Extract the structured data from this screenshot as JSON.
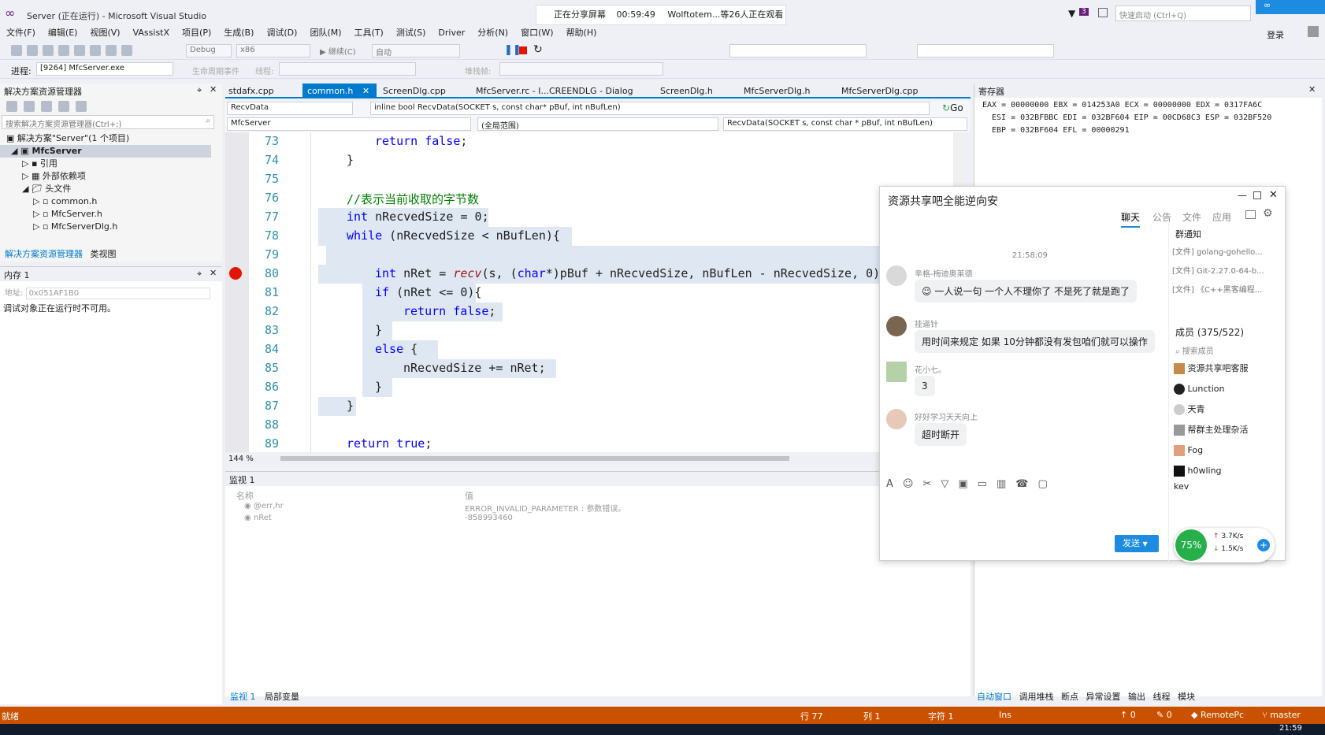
{
  "window": {
    "title": "Server (正在运行) - Microsoft Visual Studio",
    "quick_launch_placeholder": "快速启动 (Ctrl+Q)",
    "login": "登录",
    "notification_count": "3"
  },
  "sharing": {
    "label": "正在分享屏幕",
    "time": "00:59:49",
    "viewers": "Wolftotem...等26人正在观看"
  },
  "menu": [
    "文件(F)",
    "编辑(E)",
    "视图(V)",
    "VAssistX",
    "项目(P)",
    "生成(B)",
    "调试(D)",
    "团队(M)",
    "工具(T)",
    "测试(S)",
    "Driver",
    "分析(N)",
    "窗口(W)",
    "帮助(H)"
  ],
  "toolbar": {
    "config": "Debug",
    "platform": "x86",
    "continue": "继续(C)",
    "auto": "自动"
  },
  "process": {
    "label": "进程:",
    "value": "[9264] MfcServer.exe",
    "lifecycle": "生命周期事件",
    "thread": "线程:",
    "stackframe": "堆栈帧:"
  },
  "solution_explorer": {
    "title": "解决方案资源管理器",
    "search_placeholder": "搜索解决方案资源管理器(Ctrl+;)",
    "items": [
      {
        "label": "解决方案\"Server\"(1 个项目)"
      },
      {
        "label": "MfcServer"
      },
      {
        "label": "引用"
      },
      {
        "label": "外部依赖项"
      },
      {
        "label": "头文件"
      },
      {
        "label": "common.h"
      },
      {
        "label": "MfcServer.h"
      },
      {
        "label": "MfcServerDlg.h"
      }
    ],
    "tabs": [
      "解决方案资源管理器",
      "类视图"
    ]
  },
  "memory": {
    "title": "内存 1",
    "address_label": "地址:",
    "address": "0x051AF1B0",
    "message": "调试对象正在运行时不可用。"
  },
  "editor": {
    "tabs": [
      "stdafx.cpp",
      "common.h",
      "ScreenDlg.cpp",
      "MfcServer.rc - I...CREENDLG - Dialog",
      "ScreenDlg.h",
      "MfcServerDlg.h",
      "MfcServerDlg.cpp"
    ],
    "nav_function": "RecvData",
    "nav_signature": "inline bool RecvData(SOCKET s, const char* pBuf, int nBufLen)",
    "go": "Go",
    "scope_project": "MfcServer",
    "scope_global": "(全局范围)",
    "scope_member": "RecvData(SOCKET s, const char * pBuf, int nBufLen)",
    "zoom": "144 %",
    "line_numbers": [
      "73",
      "74",
      "75",
      "76",
      "77",
      "78",
      "79",
      "80",
      "81",
      "82",
      "83",
      "84",
      "85",
      "86",
      "87",
      "88",
      "89"
    ]
  },
  "registers": {
    "title": "寄存器",
    "lines": [
      "EAX = 00000000 EBX = 014253A0 ECX = 00000000 EDX = 0317FA6C",
      "ESI = 032BFBBC EDI = 032BF604 EIP = 00CD68C3 ESP = 032BF520",
      "EBP = 032BF604 EFL = 00000291"
    ]
  },
  "watch": {
    "title": "监视 1",
    "col_name": "名称",
    "col_value": "值",
    "rows": [
      {
        "name": "@err,hr",
        "value": "ERROR_INVALID_PARAMETER : 参数错误。"
      },
      {
        "name": "nRet",
        "value": "-858993460"
      }
    ],
    "tabs": [
      "监视 1",
      "局部变量"
    ]
  },
  "bottom_right_tabs": [
    "自动窗口",
    "调用堆栈",
    "断点",
    "异常设置",
    "输出",
    "线程",
    "模块"
  ],
  "status": {
    "ready": "就绪",
    "line": "行 77",
    "col": "列 1",
    "char": "字符 1",
    "ins": "Ins",
    "up": "0",
    "pencil": "0",
    "remote": "RemotePc",
    "branch": "master"
  },
  "taskbar": {
    "time": "21:59"
  },
  "chat": {
    "title": "资源共享吧全能逆向安",
    "tabs": [
      "聊天",
      "公告",
      "文件",
      "应用"
    ],
    "timestamp": "21:58:09",
    "messages": [
      {
        "sender": "辛格-梅迪奥莱德",
        "text": "一人说一句  一个人不理你了 不是死了就是跑了"
      },
      {
        "sender": "挂逼针",
        "text": "用时间来规定 如果 10分钟都没有发包咱们就可以操作"
      },
      {
        "sender": "花小七。",
        "text": "3"
      },
      {
        "sender": "好好学习天天向上",
        "text": "超时断开"
      }
    ],
    "notice_title": "群通知",
    "notices": [
      "[文件] golang-gohello...",
      "[文件] Git-2.27.0-64-b...",
      "[文件] 《C++黑客编程..."
    ],
    "members_title": "成员 (375/522)",
    "member_search": "搜索成员",
    "members": [
      "资源共享吧客服",
      "Lunction",
      "天青",
      "帮群主处理杂活",
      "Fog",
      "h0wling",
      "kev"
    ],
    "send": "发送",
    "percent": "75%",
    "up_speed": "3.7K/s",
    "down_speed": "1.5K/s"
  },
  "colors": {
    "accent": "#007acc",
    "status_bar": "#ca5100",
    "breakpoint": "#e51400",
    "active_tab": "#007acc"
  }
}
